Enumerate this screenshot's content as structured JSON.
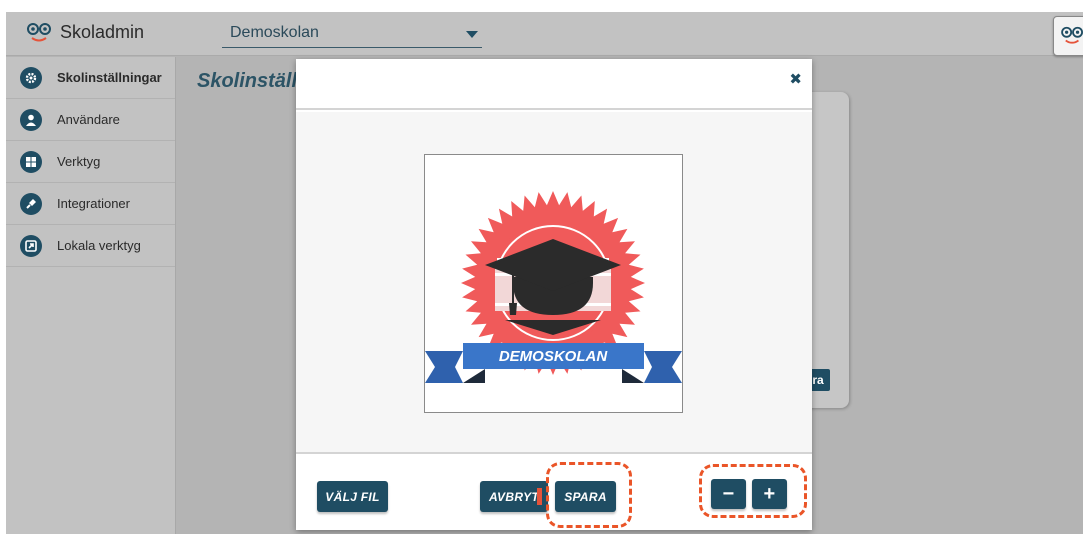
{
  "app": {
    "name": "Skoladmin"
  },
  "school_select": {
    "value": "Demoskolan"
  },
  "sidebar": {
    "items": [
      {
        "label": "Skolinställningar",
        "icon": "gear-icon",
        "active": true
      },
      {
        "label": "Användare",
        "icon": "user-icon",
        "active": false
      },
      {
        "label": "Verktyg",
        "icon": "grid-icon",
        "active": false
      },
      {
        "label": "Integrationer",
        "icon": "plug-icon",
        "active": false
      },
      {
        "label": "Lokala verktyg",
        "icon": "external-link-icon",
        "active": false
      }
    ]
  },
  "page": {
    "title": "Skolinställningar"
  },
  "background": {
    "button_label_fragment": "ra"
  },
  "modal": {
    "close_icon": "close-icon",
    "preview_logo_text": "DEMOSKOLAN",
    "buttons": {
      "choose_file": "VÄLJ FIL",
      "cancel": "AVBRYT",
      "save": "SPARA",
      "zoom_out": "−",
      "zoom_in": "+"
    }
  },
  "colors": {
    "accent": "#1f4d63",
    "badge_red": "#f05a5a",
    "ribbon_blue": "#3a76c9",
    "highlight_dash": "#ea5528"
  }
}
